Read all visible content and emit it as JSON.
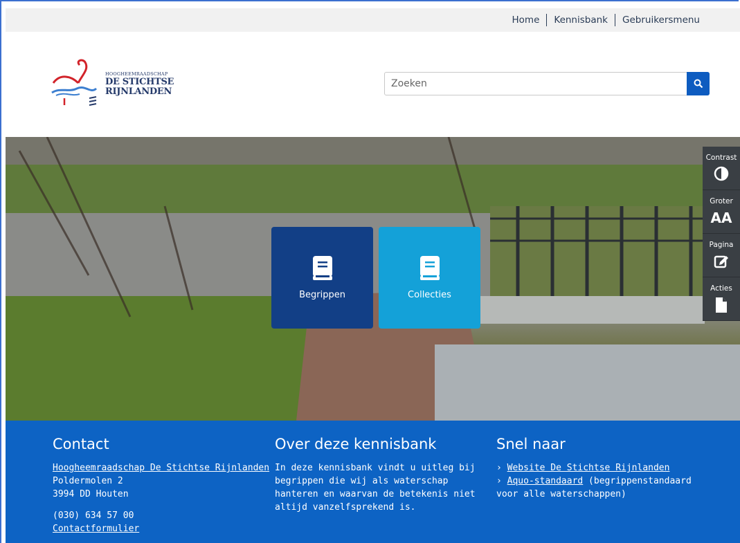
{
  "topnav": {
    "home": "Home",
    "kennisbank": "Kennisbank",
    "gebruikersmenu": "Gebruikersmenu"
  },
  "logo": {
    "line1": "HOOGHEEMRAADSCHAP",
    "line2": "DE STICHTSE",
    "line3": "RIJNLANDEN"
  },
  "search": {
    "placeholder": "Zoeken",
    "icon": "search-icon"
  },
  "tiles": [
    {
      "label": "Begrippen",
      "icon": "book-icon",
      "color": "#123f86"
    },
    {
      "label": "Collecties",
      "icon": "book-icon",
      "color": "#14a1d8"
    }
  ],
  "sidetools": [
    {
      "label": "Contrast",
      "icon": "contrast-icon"
    },
    {
      "label": "Groter",
      "icon": "text-size-icon",
      "glyph": "AA"
    },
    {
      "label": "Pagina",
      "icon": "edit-icon"
    },
    {
      "label": "Acties",
      "icon": "document-icon"
    }
  ],
  "footer": {
    "contact": {
      "heading": "Contact",
      "org_link": "Hoogheemraadschap De Stichtse Rijnlanden",
      "street": "Poldermolen 2",
      "city": "3994 DD Houten",
      "phone": "(030) 634 57 00",
      "form_link": "Contactformulier"
    },
    "about": {
      "heading": "Over deze kennisbank",
      "text": "In deze kennisbank vindt u uitleg bij begrippen die wij als waterschap hanteren en waarvan de betekenis niet altijd vanzelfsprekend is."
    },
    "quick": {
      "heading": "Snel naar",
      "link1": "Website De Stichtse Rijnlanden",
      "link2": "Aquo-standaard",
      "link2_suffix": " (begrippenstandaard voor alle waterschappen)"
    }
  },
  "colors": {
    "accent": "#0d63c4",
    "topbar": "#f1f1f1",
    "sidetool": "#3a3f44"
  }
}
